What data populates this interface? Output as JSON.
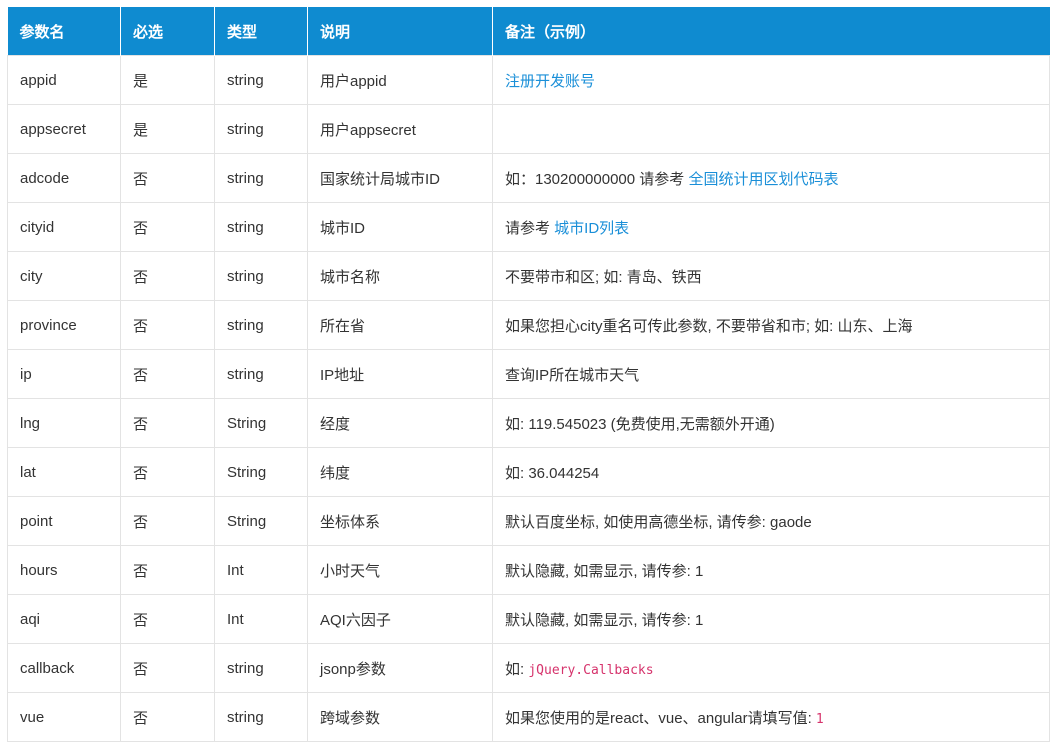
{
  "headers": [
    "参数名",
    "必选",
    "类型",
    "说明",
    "备注（示例）"
  ],
  "rows": [
    {
      "name": "appid",
      "required": "是",
      "type": "string",
      "desc": "用户appid",
      "note_link": "注册开发账号"
    },
    {
      "name": "appsecret",
      "required": "是",
      "type": "string",
      "desc": "用户appsecret"
    },
    {
      "name": "adcode",
      "required": "否",
      "type": "string",
      "desc": "国家统计局城市ID",
      "note_prefix": "如：130200000000 请参考 ",
      "note_link": "全国统计用区划代码表"
    },
    {
      "name": "cityid",
      "required": "否",
      "type": "string",
      "desc": "城市ID",
      "note_prefix": "请参考 ",
      "note_link": "城市ID列表"
    },
    {
      "name": "city",
      "required": "否",
      "type": "string",
      "desc": "城市名称",
      "note": "不要带市和区; 如: 青岛、铁西"
    },
    {
      "name": "province",
      "required": "否",
      "type": "string",
      "desc": "所在省",
      "note": "如果您担心city重名可传此参数, 不要带省和市; 如: 山东、上海"
    },
    {
      "name": "ip",
      "required": "否",
      "type": "string",
      "desc": "IP地址",
      "note": "查询IP所在城市天气"
    },
    {
      "name": "lng",
      "required": "否",
      "type": "String",
      "desc": "经度",
      "note": "如: 119.545023 (免费使用,无需额外开通)"
    },
    {
      "name": "lat",
      "required": "否",
      "type": "String",
      "desc": "纬度",
      "note": "如: 36.044254"
    },
    {
      "name": "point",
      "required": "否",
      "type": "String",
      "desc": "坐标体系",
      "note": "默认百度坐标, 如使用高德坐标, 请传参: gaode"
    },
    {
      "name": "hours",
      "required": "否",
      "type": "Int",
      "desc": "小时天气",
      "note": "默认隐藏, 如需显示, 请传参: 1"
    },
    {
      "name": "aqi",
      "required": "否",
      "type": "Int",
      "desc": "AQI六因子",
      "note": "默认隐藏, 如需显示, 请传参: 1"
    },
    {
      "name": "callback",
      "required": "否",
      "type": "string",
      "desc": "jsonp参数",
      "note_prefix": "如: ",
      "note_code": "jQuery.Callbacks"
    },
    {
      "name": "vue",
      "required": "否",
      "type": "string",
      "desc": "跨域参数",
      "note_prefix": "如果您使用的是react、vue、angular请填写值: ",
      "note_code": "1"
    }
  ],
  "colors": {
    "header_bg": "#0f8bd0",
    "link": "#1a8fd8",
    "code": "#d6336c",
    "border": "#e3e3e3"
  }
}
